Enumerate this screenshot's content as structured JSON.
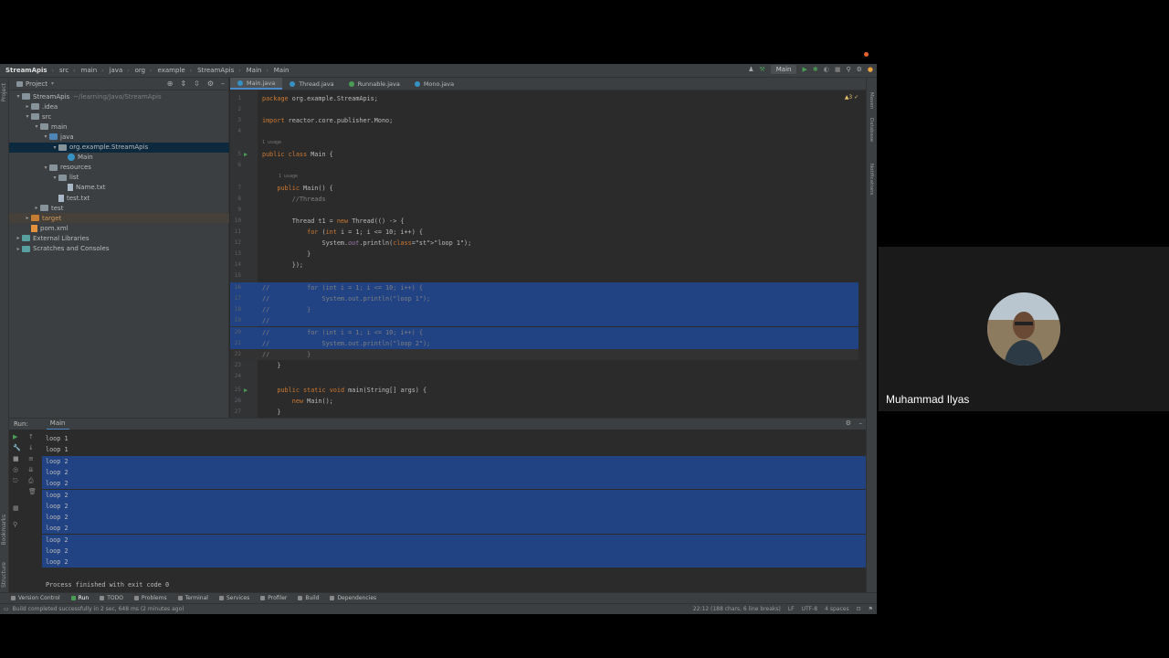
{
  "breadcrumbs": [
    "StreamApis",
    "src",
    "main",
    "java",
    "org",
    "example",
    "StreamApis",
    "Main",
    "Main"
  ],
  "run_config": "Main",
  "project_panel": {
    "title": "Project",
    "tree": [
      {
        "label": "StreamApis",
        "extra": "~/learning/Java/StreamApis",
        "indent": 0,
        "icon": "folder",
        "arrow": "▾"
      },
      {
        "label": ".idea",
        "indent": 1,
        "icon": "folder",
        "arrow": "▸"
      },
      {
        "label": "src",
        "indent": 1,
        "icon": "folder",
        "arrow": "▾"
      },
      {
        "label": "main",
        "indent": 2,
        "icon": "folder",
        "arrow": "▾"
      },
      {
        "label": "java",
        "indent": 3,
        "icon": "folder-blue",
        "arrow": "▾"
      },
      {
        "label": "org.example.StreamApis",
        "indent": 4,
        "icon": "folder",
        "arrow": "▾",
        "selected": true
      },
      {
        "label": "Main",
        "indent": 5,
        "icon": "class",
        "arrow": ""
      },
      {
        "label": "resources",
        "indent": 3,
        "icon": "folder",
        "arrow": "▾"
      },
      {
        "label": "list",
        "indent": 4,
        "icon": "folder",
        "arrow": "▾"
      },
      {
        "label": "Name.txt",
        "indent": 5,
        "icon": "file",
        "arrow": ""
      },
      {
        "label": "test.txt",
        "indent": 4,
        "icon": "file",
        "arrow": ""
      },
      {
        "label": "test",
        "indent": 2,
        "icon": "folder",
        "arrow": "▸"
      },
      {
        "label": "target",
        "indent": 1,
        "icon": "folder-orange",
        "arrow": "▸",
        "highlight": true
      },
      {
        "label": "pom.xml",
        "indent": 1,
        "icon": "xml",
        "arrow": ""
      },
      {
        "label": "External Libraries",
        "indent": 0,
        "icon": "folder-teal",
        "arrow": "▸"
      },
      {
        "label": "Scratches and Consoles",
        "indent": 0,
        "icon": "folder-teal",
        "arrow": "▸"
      }
    ]
  },
  "tabs": [
    "Main.java",
    "Thread.java",
    "Runnable.java",
    "Mono.java"
  ],
  "editor": {
    "warnings": "▲3 ✓1",
    "lines": [
      {
        "n": "1",
        "code": "package org.example.StreamApis;"
      },
      {
        "n": "2",
        "code": ""
      },
      {
        "n": "3",
        "code": "import reactor.core.publisher.Mono;"
      },
      {
        "n": "4",
        "code": ""
      },
      {
        "n": "5",
        "code": "public class Main {",
        "hint": "1 usage",
        "run": true
      },
      {
        "n": "6",
        "code": ""
      },
      {
        "n": "7",
        "code": "    public Main() {",
        "hint": "1 usage"
      },
      {
        "n": "8",
        "code": "        //Threads"
      },
      {
        "n": "9",
        "code": ""
      },
      {
        "n": "10",
        "code": "        Thread t1 = new Thread(() -> {"
      },
      {
        "n": "11",
        "code": "            for (int i = 1; i <= 10; i++) {"
      },
      {
        "n": "12",
        "code": "                System.out.println(\"loop 1\");"
      },
      {
        "n": "13",
        "code": "            }"
      },
      {
        "n": "14",
        "code": "        });"
      },
      {
        "n": "15",
        "code": ""
      },
      {
        "n": "16",
        "code": "//          for (int i = 1; i <= 10; i++) {",
        "sel": true
      },
      {
        "n": "17",
        "code": "//              System.out.println(\"loop 1\");",
        "sel": true
      },
      {
        "n": "18",
        "code": "//          }",
        "sel": true
      },
      {
        "n": "19",
        "code": "//",
        "sel": true
      },
      {
        "n": "20",
        "code": "//          for (int i = 1; i <= 10; i++) {",
        "sel": true
      },
      {
        "n": "21",
        "code": "//              System.out.println(\"loop 2\");",
        "sel": true
      },
      {
        "n": "22",
        "code": "//          }",
        "caret": true
      },
      {
        "n": "23",
        "code": "    }"
      },
      {
        "n": "24",
        "code": ""
      },
      {
        "n": "25",
        "code": "    public static void main(String[] args) {",
        "run": true
      },
      {
        "n": "26",
        "code": "        new Main();"
      },
      {
        "n": "27",
        "code": "    }"
      }
    ]
  },
  "run_panel": {
    "label": "Run:",
    "tab": "Main",
    "output": [
      {
        "text": "loop 1",
        "sel": false
      },
      {
        "text": "loop 1",
        "sel": false
      },
      {
        "text": "loop 2",
        "sel": true
      },
      {
        "text": "loop 2",
        "sel": true
      },
      {
        "text": "loop 2",
        "sel": true
      },
      {
        "text": "loop 2",
        "sel": true
      },
      {
        "text": "loop 2",
        "sel": true
      },
      {
        "text": "loop 2",
        "sel": true
      },
      {
        "text": "loop 2",
        "sel": true
      },
      {
        "text": "loop 2",
        "sel": true
      },
      {
        "text": "loop 2",
        "sel": true
      },
      {
        "text": "loop 2",
        "sel": true
      },
      {
        "text": "",
        "sel": false
      },
      {
        "text": "Process finished with exit code 0",
        "sel": false
      }
    ]
  },
  "bottom_tools": [
    "Version Control",
    "Run",
    "TODO",
    "Problems",
    "Terminal",
    "Services",
    "Profiler",
    "Build",
    "Dependencies"
  ],
  "status": {
    "message": "Build completed successfully in 2 sec, 648 ms (2 minutes ago)",
    "position": "22:12 (188 chars, 6 line breaks)",
    "line_sep": "LF",
    "encoding": "UTF-8",
    "indent": "4 spaces"
  },
  "side_labels": {
    "left": [
      "Project",
      "Bookmarks",
      "Structure"
    ],
    "right": [
      "Maven",
      "Database",
      "Notifications"
    ]
  },
  "participant": {
    "name": "Muhammad Ilyas"
  },
  "colors": {
    "selection": "#214283",
    "editor_bg": "#2b2b2b",
    "panel_bg": "#3c3f41",
    "accent": "#4a88c7"
  }
}
